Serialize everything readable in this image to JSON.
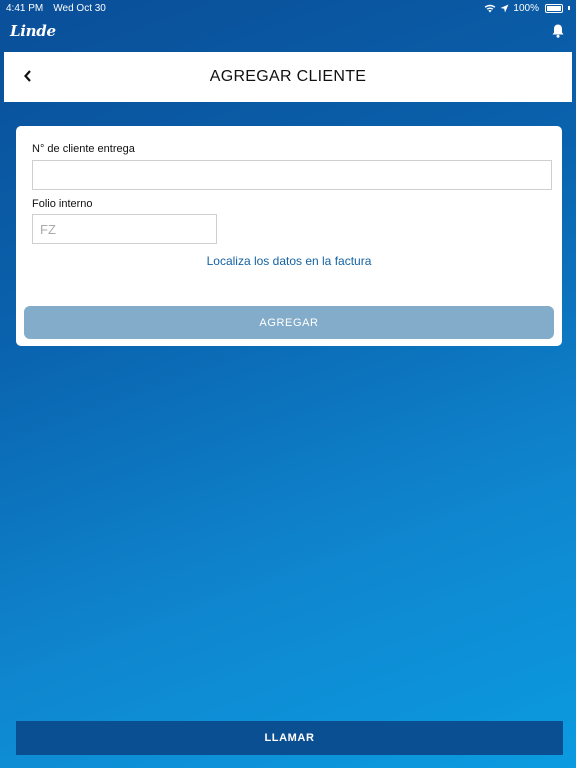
{
  "status_bar": {
    "time": "4:41 PM",
    "date": "Wed Oct 30",
    "battery": "100%",
    "icons": [
      "wifi-icon",
      "location-arrow-icon",
      "battery-icon"
    ]
  },
  "brand": {
    "logo_text": "Linde"
  },
  "header": {
    "title": "AGREGAR CLIENTE",
    "back_icon": "chevron-left-icon"
  },
  "form": {
    "customer_number": {
      "label": "N° de cliente entrega",
      "value": "",
      "placeholder": ""
    },
    "folio": {
      "label": "Folio interno",
      "value": "",
      "placeholder": "FZ"
    },
    "help_link": "Localiza los datos en la factura",
    "submit_label": "AGREGAR"
  },
  "footer": {
    "call_label": "LLAMAR"
  },
  "colors": {
    "primary": "#0b4f93",
    "link": "#1463a3",
    "disabled_button": "#82acca",
    "card": "#ffffff"
  }
}
